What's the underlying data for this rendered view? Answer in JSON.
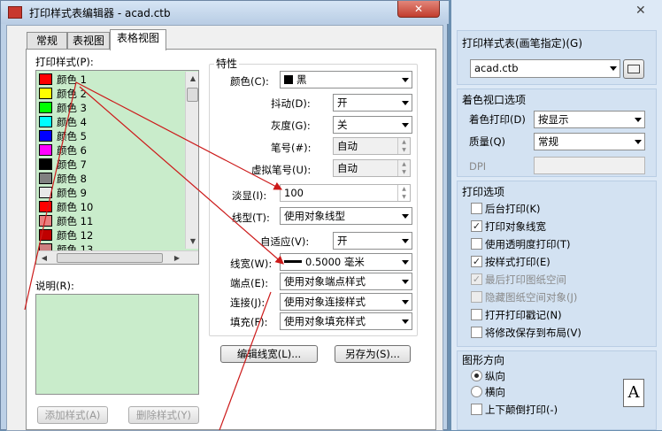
{
  "window": {
    "title": "打印样式表编辑器 - acad.ctb",
    "close_label": "✕"
  },
  "tabs": [
    {
      "label": "常规"
    },
    {
      "label": "表视图"
    },
    {
      "label": "表格视图",
      "active": true
    }
  ],
  "style_list": {
    "label": "打印样式(P):",
    "items": [
      {
        "name": "颜色 1",
        "color": "#ff0000"
      },
      {
        "name": "颜色 2",
        "color": "#ffff00"
      },
      {
        "name": "颜色 3",
        "color": "#00ff00"
      },
      {
        "name": "颜色 4",
        "color": "#00ffff"
      },
      {
        "name": "颜色 5",
        "color": "#0000ff"
      },
      {
        "name": "颜色 6",
        "color": "#ff00ff"
      },
      {
        "name": "颜色 7",
        "color": "#000000"
      },
      {
        "name": "颜色 8",
        "color": "#808080"
      },
      {
        "name": "颜色 9",
        "color": "#e8e8e8"
      },
      {
        "name": "颜色 10",
        "color": "#ff0000"
      },
      {
        "name": "颜色 11",
        "color": "#e88080"
      },
      {
        "name": "颜色 12",
        "color": "#c00000"
      },
      {
        "name": "颜色 13",
        "color": "#d08080"
      }
    ]
  },
  "description": {
    "label": "说明(R):"
  },
  "buttons": {
    "add_style": "添加样式(A)",
    "delete_style": "删除样式(Y)",
    "edit_lineweights": "编辑线宽(L)...",
    "save_as": "另存为(S)..."
  },
  "properties": {
    "group_label": "特性",
    "color": {
      "label": "颜色(C):",
      "value": "黑"
    },
    "dither": {
      "label": "抖动(D):",
      "value": "开"
    },
    "grayscale": {
      "label": "灰度(G):",
      "value": "关"
    },
    "pen": {
      "label": "笔号(#):",
      "value": "自动"
    },
    "virtual_pen": {
      "label": "虚拟笔号(U):",
      "value": "自动"
    },
    "screening": {
      "label": "淡显(I):",
      "value": "100"
    },
    "linetype": {
      "label": "线型(T):",
      "value": "使用对象线型"
    },
    "adaptive": {
      "label": "自适应(V):",
      "value": "开"
    },
    "lineweight": {
      "label": "线宽(W):",
      "value": "0.5000 毫米"
    },
    "line_end": {
      "label": "端点(E):",
      "value": "使用对象端点样式"
    },
    "line_join": {
      "label": "连接(J):",
      "value": "使用对象连接样式"
    },
    "fill": {
      "label": "填充(F):",
      "value": "使用对象填充样式"
    }
  },
  "right_panel": {
    "close_label": "✕",
    "plot_style_table": {
      "label": "打印样式表(画笔指定)(G)",
      "value": "acad.ctb"
    },
    "shaded_viewport": {
      "label": "着色视口选项",
      "shade_plot": {
        "label": "着色打印(D)",
        "value": "按显示"
      },
      "quality": {
        "label": "质量(Q)",
        "value": "常规"
      },
      "dpi": {
        "label": "DPI"
      }
    },
    "plot_options": {
      "label": "打印选项",
      "items": [
        {
          "label": "后台打印(K)",
          "checked": false,
          "enabled": true
        },
        {
          "label": "打印对象线宽",
          "checked": true,
          "enabled": true
        },
        {
          "label": "使用透明度打印(T)",
          "checked": false,
          "enabled": true
        },
        {
          "label": "按样式打印(E)",
          "checked": true,
          "enabled": true
        },
        {
          "label": "最后打印图纸空间",
          "checked": true,
          "enabled": false
        },
        {
          "label": "隐藏图纸空间对象(J)",
          "checked": false,
          "enabled": false
        },
        {
          "label": "打开打印戳记(N)",
          "checked": false,
          "enabled": true
        },
        {
          "label": "将修改保存到布局(V)",
          "checked": false,
          "enabled": true
        }
      ]
    },
    "orientation": {
      "label": "图形方向",
      "portrait": "纵向",
      "landscape": "横向",
      "upside_down": "上下颠倒打印(-)",
      "preview_letter": "A"
    }
  },
  "colors": {
    "list_bg": "#c9eccb",
    "arrow": "#cc1a1a"
  }
}
